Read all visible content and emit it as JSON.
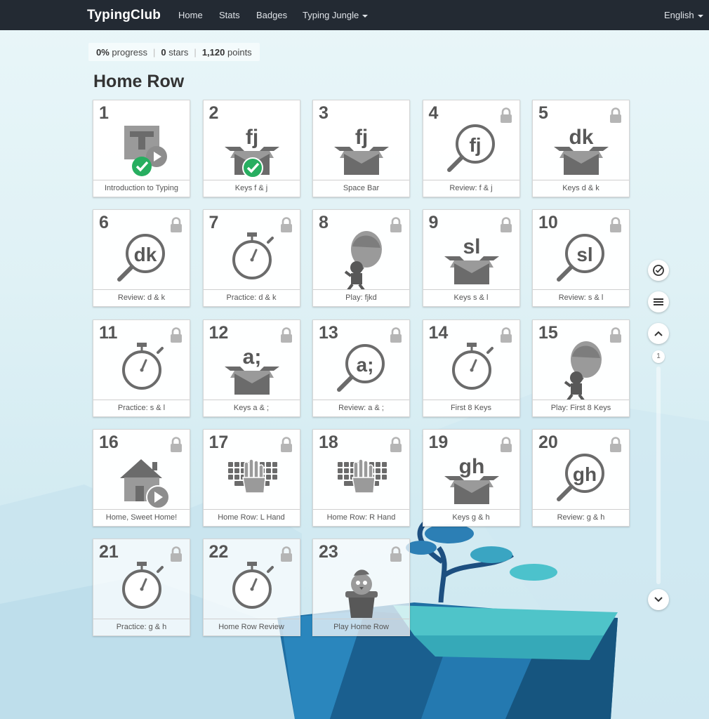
{
  "nav": {
    "brand": "TypingClub",
    "links": [
      "Home",
      "Stats",
      "Badges",
      "Typing Jungle"
    ],
    "language": "English"
  },
  "stats": {
    "progress_value": "0%",
    "progress_label": "progress",
    "stars_value": "0",
    "stars_label": "stars",
    "points_value": "1,120",
    "points_label": "points"
  },
  "section_title": "Home Row",
  "lessons": [
    {
      "num": "1",
      "label": "Introduction to Typing",
      "icon": "intro-video-icon",
      "status": "completed",
      "locked": false
    },
    {
      "num": "2",
      "label": "Keys f & j",
      "icon": "key-box-icon",
      "keys": "fj",
      "status": "completed",
      "locked": false
    },
    {
      "num": "3",
      "label": "Space Bar",
      "icon": "key-box-icon",
      "keys": "fj",
      "status": "open",
      "locked": false
    },
    {
      "num": "4",
      "label": "Review: f & j",
      "icon": "magnifier-icon",
      "keys": "fj",
      "locked": true
    },
    {
      "num": "5",
      "label": "Keys d & k",
      "icon": "key-box-icon",
      "keys": "dk",
      "locked": true
    },
    {
      "num": "6",
      "label": "Review: d & k",
      "icon": "magnifier-icon",
      "keys": "dk",
      "locked": true
    },
    {
      "num": "7",
      "label": "Practice: d & k",
      "icon": "stopwatch-icon",
      "locked": true
    },
    {
      "num": "8",
      "label": "Play: fjkd",
      "icon": "balloon-game-icon",
      "locked": true
    },
    {
      "num": "9",
      "label": "Keys s & l",
      "icon": "key-box-icon",
      "keys": "sl",
      "locked": true
    },
    {
      "num": "10",
      "label": "Review: s & l",
      "icon": "magnifier-icon",
      "keys": "sl",
      "locked": true
    },
    {
      "num": "11",
      "label": "Practice: s & l",
      "icon": "stopwatch-icon",
      "locked": true
    },
    {
      "num": "12",
      "label": "Keys a & ;",
      "icon": "key-box-icon",
      "keys": "a;",
      "locked": true
    },
    {
      "num": "13",
      "label": "Review: a & ;",
      "icon": "magnifier-icon",
      "keys": "a;",
      "locked": true
    },
    {
      "num": "14",
      "label": "First 8 Keys",
      "icon": "stopwatch-icon",
      "locked": true
    },
    {
      "num": "15",
      "label": "Play: First 8 Keys",
      "icon": "balloon-game-icon",
      "locked": true
    },
    {
      "num": "16",
      "label": "Home, Sweet Home!",
      "icon": "home-video-icon",
      "locked": true
    },
    {
      "num": "17",
      "label": "Home Row: L Hand",
      "icon": "keyboard-hand-icon",
      "locked": true
    },
    {
      "num": "18",
      "label": "Home Row: R Hand",
      "icon": "keyboard-hand-icon",
      "locked": true
    },
    {
      "num": "19",
      "label": "Keys g & h",
      "icon": "key-box-icon",
      "keys": "gh",
      "locked": true
    },
    {
      "num": "20",
      "label": "Review: g & h",
      "icon": "magnifier-icon",
      "keys": "gh",
      "locked": true
    },
    {
      "num": "21",
      "label": "Practice: g & h",
      "icon": "stopwatch-icon",
      "locked": true
    },
    {
      "num": "22",
      "label": "Home Row Review",
      "icon": "stopwatch-icon",
      "locked": true
    },
    {
      "num": "23",
      "label": "Play Home Row",
      "icon": "bird-pot-game-icon",
      "locked": true
    }
  ],
  "side_controls": {
    "page_indicator": "1",
    "icons": [
      "check-circle-icon",
      "menu-icon",
      "chevron-up-icon",
      "chevron-down-icon"
    ]
  },
  "colors": {
    "navbar": "#232a33",
    "icon_gray": "#6b6b6b",
    "check_green": "#27ae60"
  }
}
